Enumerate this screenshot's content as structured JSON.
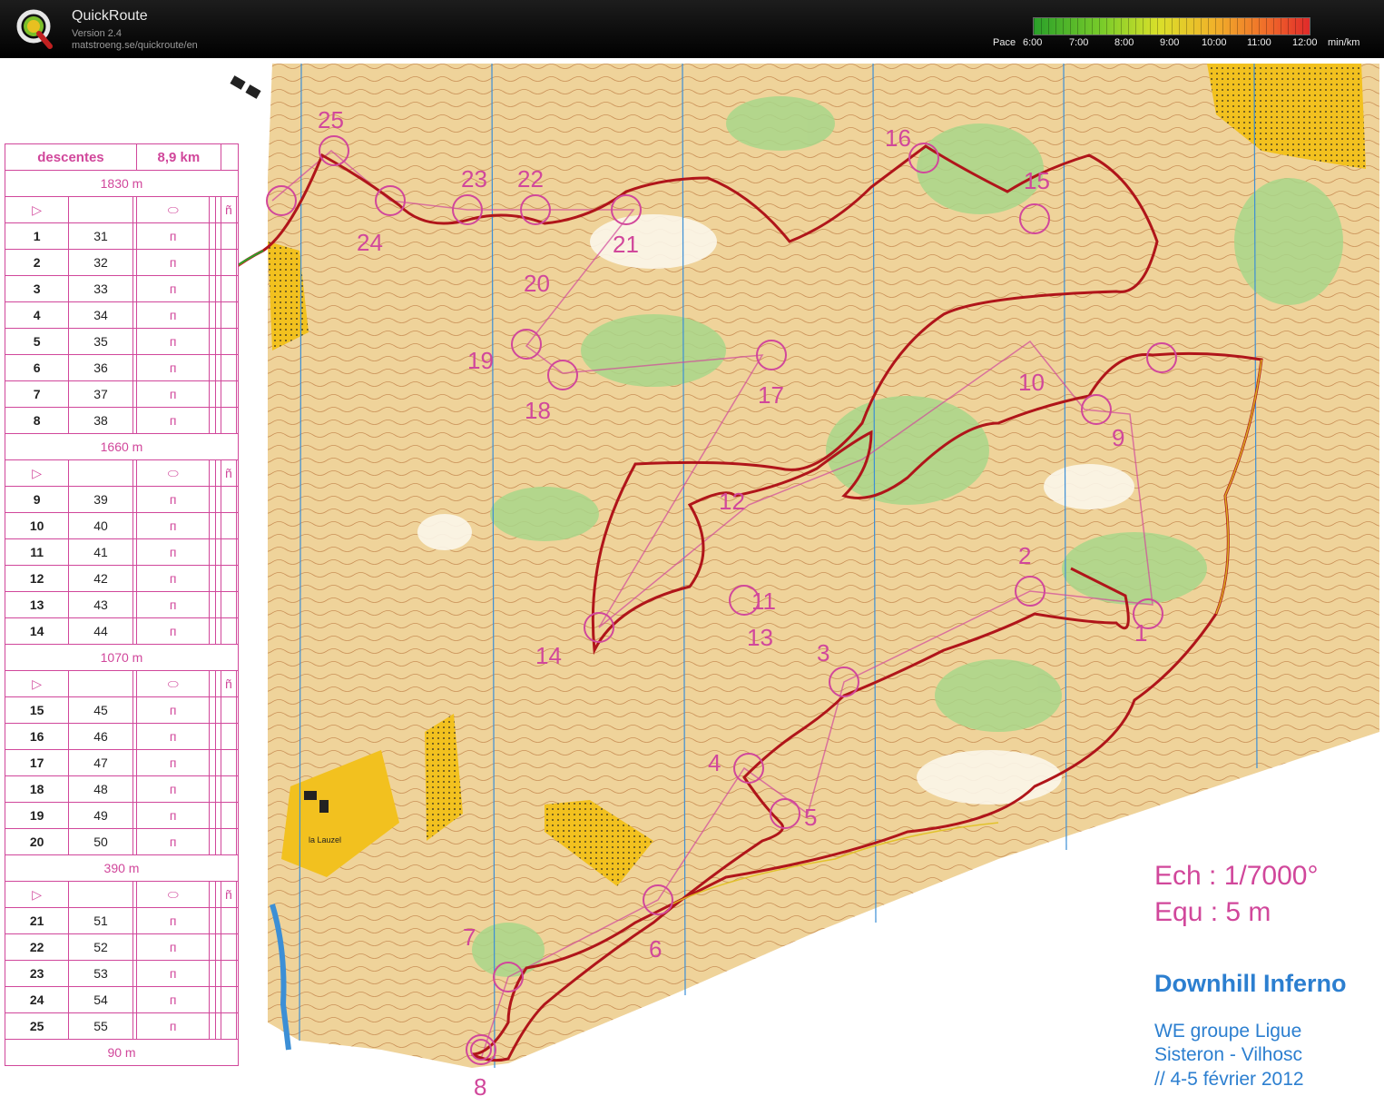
{
  "app": {
    "name": "QuickRoute",
    "version": "Version 2.4",
    "url": "matstroeng.se/quickroute/en"
  },
  "pace_scale": {
    "label": "Pace",
    "unit": "min/km",
    "values": [
      "6:00",
      "7:00",
      "8:00",
      "9:00",
      "10:00",
      "11:00",
      "12:00"
    ],
    "gradient": [
      "#2aa02a",
      "#7acc2a",
      "#d9e02a",
      "#f0b32a",
      "#f06a2a",
      "#e02a2a"
    ]
  },
  "colors": {
    "route": "#b0151a",
    "course": "#d1479b",
    "event_text": "#2c7fd0"
  },
  "description_sheet": {
    "title": "descentes",
    "length": "8,9 km",
    "legs": [
      {
        "distance": "1830 m",
        "controls": [
          {
            "n": "1",
            "code": "31"
          },
          {
            "n": "2",
            "code": "32"
          },
          {
            "n": "3",
            "code": "33"
          },
          {
            "n": "4",
            "code": "34"
          },
          {
            "n": "5",
            "code": "35"
          },
          {
            "n": "6",
            "code": "36"
          },
          {
            "n": "7",
            "code": "37"
          },
          {
            "n": "8",
            "code": "38"
          }
        ]
      },
      {
        "distance": "1660 m",
        "controls": [
          {
            "n": "9",
            "code": "39"
          },
          {
            "n": "10",
            "code": "40"
          },
          {
            "n": "11",
            "code": "41"
          },
          {
            "n": "12",
            "code": "42"
          },
          {
            "n": "13",
            "code": "43"
          },
          {
            "n": "14",
            "code": "44"
          }
        ]
      },
      {
        "distance": "1070 m",
        "controls": [
          {
            "n": "15",
            "code": "45"
          },
          {
            "n": "16",
            "code": "46"
          },
          {
            "n": "17",
            "code": "47"
          },
          {
            "n": "18",
            "code": "48"
          },
          {
            "n": "19",
            "code": "49"
          },
          {
            "n": "20",
            "code": "50"
          }
        ]
      },
      {
        "distance": "390 m",
        "controls": [
          {
            "n": "21",
            "code": "51"
          },
          {
            "n": "22",
            "code": "52"
          },
          {
            "n": "23",
            "code": "53"
          },
          {
            "n": "24",
            "code": "54"
          },
          {
            "n": "25",
            "code": "55"
          }
        ]
      }
    ],
    "finish_distance": "90 m"
  },
  "map_labels": {
    "controls": [
      "25",
      "24",
      "23",
      "22",
      "21",
      "20",
      "19",
      "18",
      "17",
      "16",
      "15",
      "10",
      "9",
      "14",
      "13",
      "12",
      "11",
      "4",
      "5",
      "3",
      "2",
      "1",
      "7",
      "6",
      "8"
    ],
    "place": "la Lauzel"
  },
  "map_info": {
    "scale": "Ech : 1/7000°",
    "equidistance": "Equ : 5 m",
    "event_title": "Downhill Inferno",
    "event_line1": "WE groupe Ligue",
    "event_line2": "Sisteron - Vilhosc",
    "event_line3": "// 4-5 février 2012"
  }
}
